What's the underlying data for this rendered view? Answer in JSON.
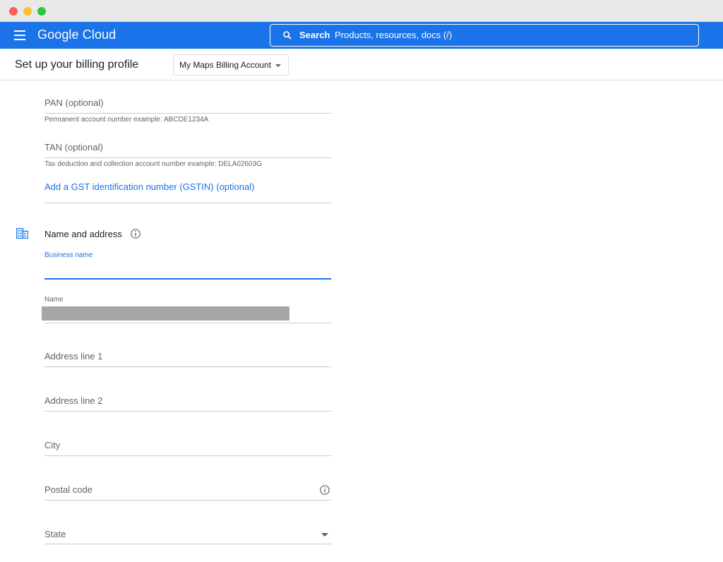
{
  "app": {
    "logo_text": "Google Cloud",
    "search_label": "Search",
    "search_placeholder": "Products, resources, docs (/)",
    "brand_color": "#1a73e8"
  },
  "header": {
    "title": "Set up your billing profile",
    "account_selected": "My Maps Billing Account"
  },
  "tax": {
    "pan_label": "PAN (optional)",
    "pan_helper": "Permanent account number example: ABCDE1234A",
    "tan_label": "TAN (optional)",
    "tan_helper": "Tax deduction and collection account number example: DELA02603G",
    "gstin_link": "Add a GST identification number (GSTIN) (optional)"
  },
  "address": {
    "section_title": "Name and address",
    "business_name_label": "Business name",
    "business_name_value": "",
    "name_label": "Name",
    "address1_label": "Address line 1",
    "address2_label": "Address line 2",
    "city_label": "City",
    "postal_label": "Postal code",
    "state_label": "State"
  },
  "icons": {
    "menu": "hamburger-menu-icon",
    "search": "search-icon",
    "building": "building-icon",
    "info": "info-icon",
    "dropdown": "chevron-down-icon"
  }
}
